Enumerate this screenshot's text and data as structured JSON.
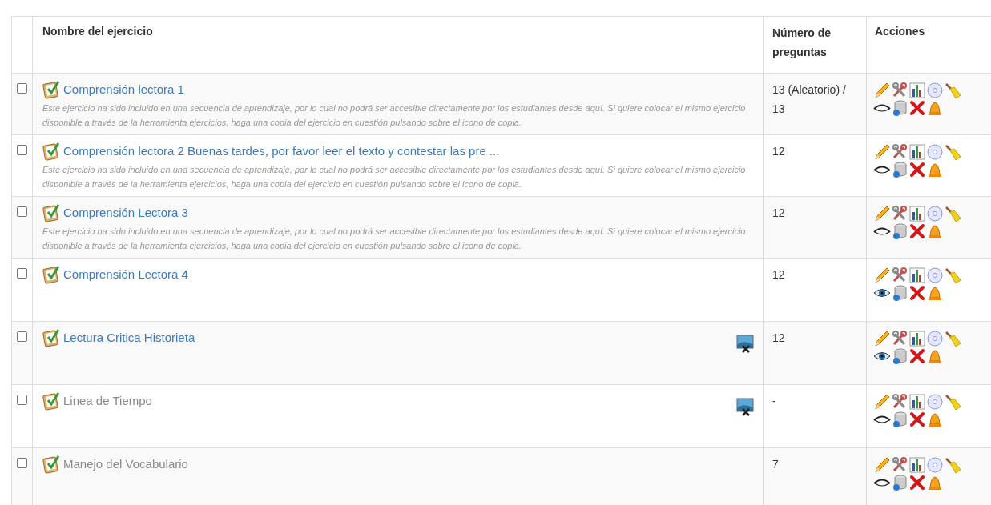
{
  "table": {
    "columns": [
      "Nombre del ejercicio",
      "Número de preguntas",
      "Acciones"
    ],
    "rows": [
      {
        "checked": false,
        "title": "Comprensión lectora 1",
        "active": true,
        "note": "Este ejercicio ha sido incluido en una secuencia de aprendizaje, por lo cual no podrá ser accesible directamente por los estudiantes desde aquí. Si quiere colocar el mismo ejercicio disponible a través de la herramienta ejercicios, haga una copia del ejercicio en cuestión pulsando sobre el icono de copia.",
        "media": false,
        "count": "13 (Aleatorio) / 13",
        "visible": false
      },
      {
        "checked": false,
        "title": "Comprensión lectora 2 Buenas tardes, por favor leer el texto y contestar las pre ...",
        "active": true,
        "note": "Este ejercicio ha sido incluido en una secuencia de aprendizaje, por lo cual no podrá ser accesible directamente por los estudiantes desde aquí. Si quiere colocar el mismo ejercicio disponible a través de la herramienta ejercicios, haga una copia del ejercicio en cuestión pulsando sobre el icono de copia.",
        "media": false,
        "count": "12",
        "visible": false
      },
      {
        "checked": false,
        "title": "Comprensión Lectora 3",
        "active": true,
        "note": "Este ejercicio ha sido incluido en una secuencia de aprendizaje, por lo cual no podrá ser accesible directamente por los estudiantes desde aquí. Si quiere colocar el mismo ejercicio disponible a través de la herramienta ejercicios, haga una copia del ejercicio en cuestión pulsando sobre el icono de copia.",
        "media": false,
        "count": "12",
        "visible": false
      },
      {
        "checked": false,
        "title": "Comprensión Lectora 4",
        "active": true,
        "media": false,
        "count": "12",
        "visible": true
      },
      {
        "checked": false,
        "title": "Lectura Critica Historieta",
        "active": true,
        "media": true,
        "count": "12",
        "visible": true
      },
      {
        "checked": false,
        "title": "Linea de Tiempo",
        "active": false,
        "media": true,
        "count": "-",
        "visible": false
      },
      {
        "checked": false,
        "title": "Manejo del Vocabulario",
        "active": false,
        "media": false,
        "count": "7",
        "visible": false
      }
    ]
  }
}
